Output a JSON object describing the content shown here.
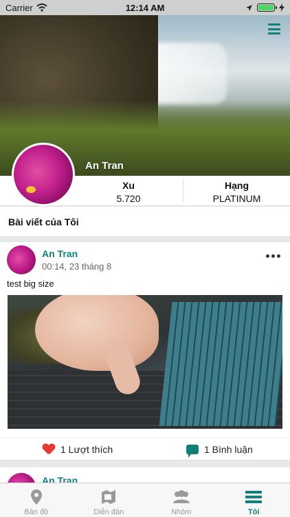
{
  "status_bar": {
    "carrier": "Carrier",
    "time": "12:14 AM"
  },
  "profile": {
    "name": "An Tran"
  },
  "stats": {
    "xu": {
      "label": "Xu",
      "value": "5.720"
    },
    "rank": {
      "label": "Hạng",
      "value": "PLATINUM"
    }
  },
  "section": {
    "title": "Bài viết của Tôi"
  },
  "post": {
    "author": "An Tran",
    "time": "00:14, 23 tháng 8",
    "text": "test big size",
    "likes_label": "1 Lượt thích",
    "comments_label": "1 Bình luận"
  },
  "next_post": {
    "author": "An Tran"
  },
  "tabs": [
    {
      "label": "Bản đồ",
      "icon": "map-pin-icon"
    },
    {
      "label": "Diễn đàn",
      "icon": "forum-icon"
    },
    {
      "label": "Nhóm",
      "icon": "group-icon"
    },
    {
      "label": "Tôi",
      "icon": "menu-icon"
    }
  ],
  "colors": {
    "accent": "#12807a",
    "like": "#e53935",
    "battery": "#4cd964"
  }
}
